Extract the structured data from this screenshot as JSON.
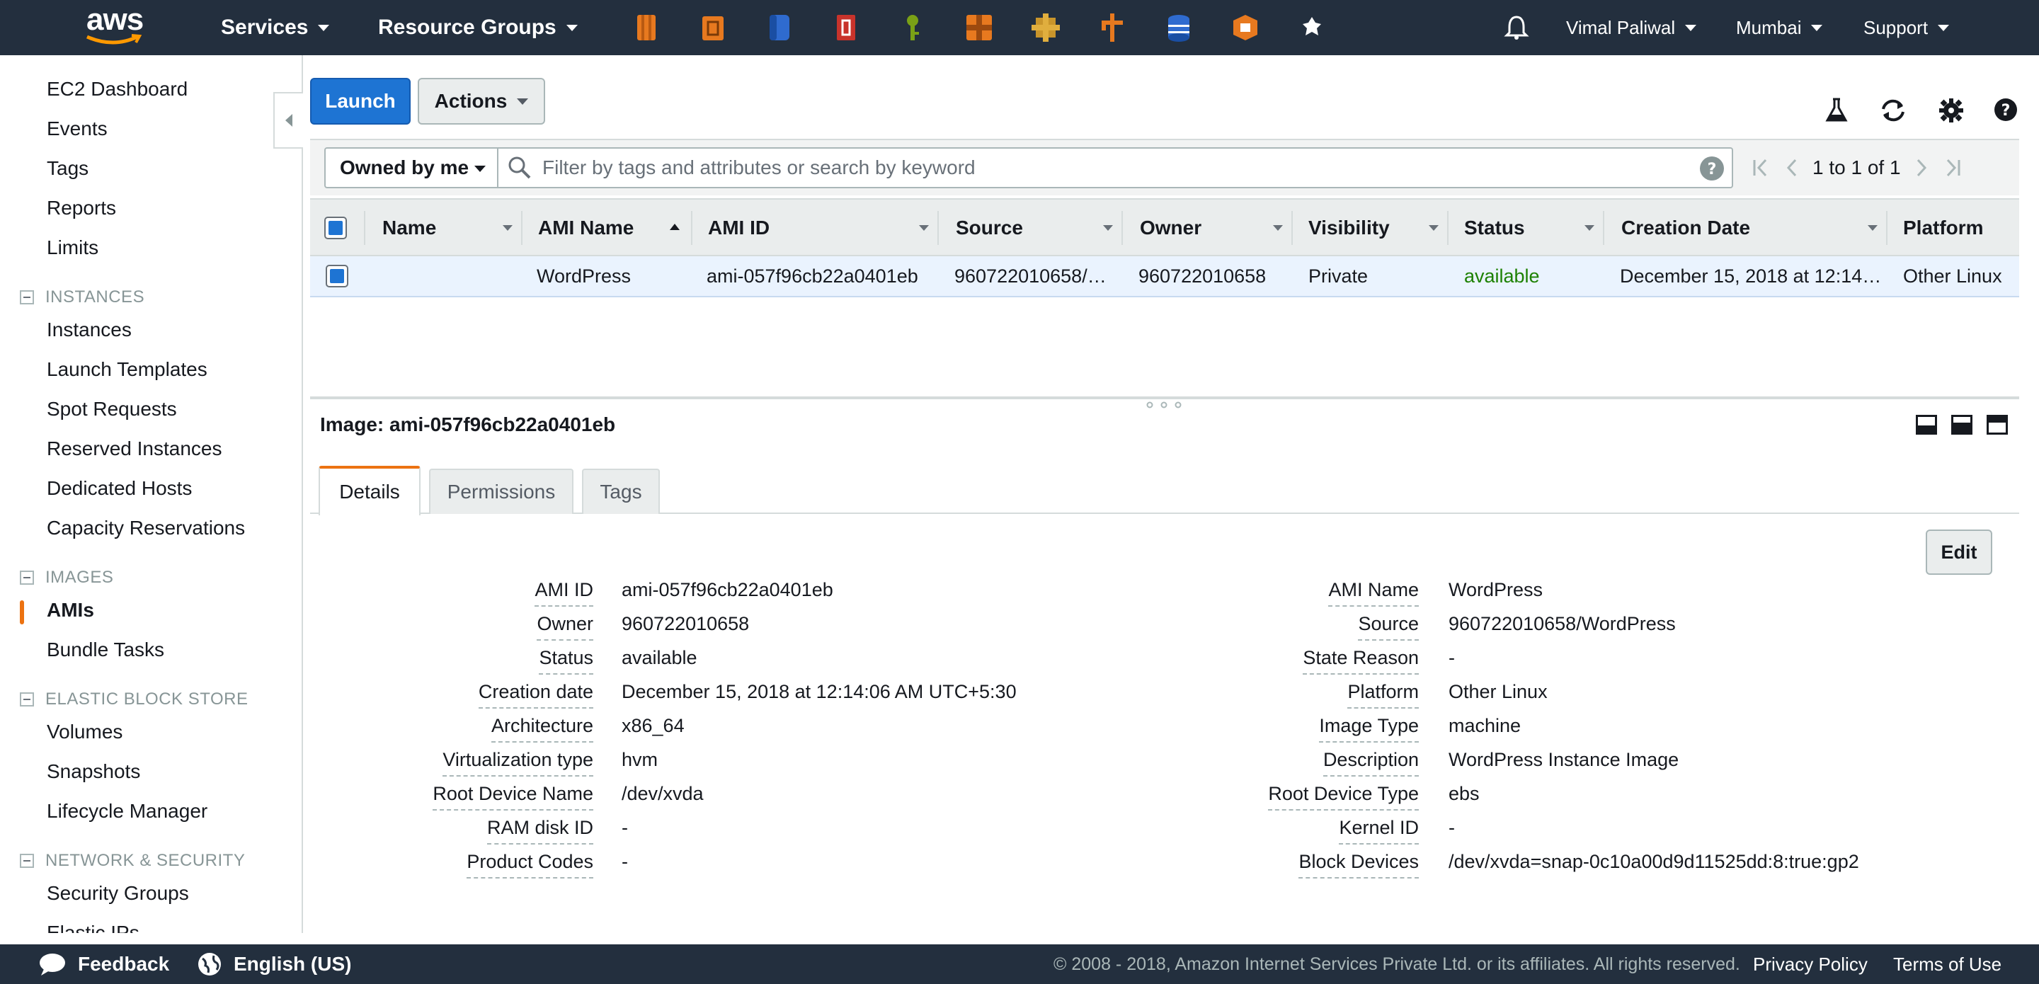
{
  "topnav": {
    "logo": "aws",
    "services": "Services",
    "resource_groups": "Resource Groups",
    "service_icons": [
      "ec2-icon",
      "ecs-icon",
      "s3-icon",
      "codedeploy-icon",
      "iam-icon",
      "api-gateway-icon",
      "cloudwatch-icon",
      "lambda-icon",
      "dynamodb-icon",
      "cloudformation-icon",
      "pin-icon"
    ],
    "user": "Vimal Paliwal",
    "region": "Mumbai",
    "support": "Support"
  },
  "sidebar": {
    "top": [
      "EC2 Dashboard",
      "Events",
      "Tags",
      "Reports",
      "Limits"
    ],
    "sections": [
      {
        "title": "INSTANCES",
        "items": [
          "Instances",
          "Launch Templates",
          "Spot Requests",
          "Reserved Instances",
          "Dedicated Hosts",
          "Capacity Reservations"
        ]
      },
      {
        "title": "IMAGES",
        "items": [
          "AMIs",
          "Bundle Tasks"
        ]
      },
      {
        "title": "ELASTIC BLOCK STORE",
        "items": [
          "Volumes",
          "Snapshots",
          "Lifecycle Manager"
        ]
      },
      {
        "title": "NETWORK & SECURITY",
        "items": [
          "Security Groups",
          "Elastic IPs"
        ]
      }
    ],
    "active": "AMIs"
  },
  "toolbar": {
    "launch": "Launch",
    "actions": "Actions"
  },
  "filter": {
    "owned": "Owned by me",
    "placeholder": "Filter by tags and attributes or search by keyword",
    "pagination": "1 to 1 of 1"
  },
  "table": {
    "columns": [
      "Name",
      "AMI Name",
      "AMI ID",
      "Source",
      "Owner",
      "Visibility",
      "Status",
      "Creation Date",
      "Platform"
    ],
    "rows": [
      {
        "name": "",
        "ami_name": "WordPress",
        "ami_id": "ami-057f96cb22a0401eb",
        "source": "960722010658/…",
        "owner": "960722010658",
        "visibility": "Private",
        "status": "available",
        "creation_date": "December 15, 2018 at 12:14…",
        "platform": "Other Linux"
      }
    ]
  },
  "detail": {
    "title": "Image: ami-057f96cb22a0401eb",
    "tabs": [
      "Details",
      "Permissions",
      "Tags"
    ],
    "edit": "Edit",
    "left": [
      {
        "label": "AMI ID",
        "value": "ami-057f96cb22a0401eb"
      },
      {
        "label": "Owner",
        "value": "960722010658"
      },
      {
        "label": "Status",
        "value": "available"
      },
      {
        "label": "Creation date",
        "value": "December 15, 2018 at 12:14:06 AM UTC+5:30"
      },
      {
        "label": "Architecture",
        "value": "x86_64"
      },
      {
        "label": "Virtualization type",
        "value": "hvm"
      },
      {
        "label": "Root Device Name",
        "value": "/dev/xvda"
      },
      {
        "label": "RAM disk ID",
        "value": "-"
      },
      {
        "label": "Product Codes",
        "value": "-"
      }
    ],
    "right": [
      {
        "label": "AMI Name",
        "value": "WordPress"
      },
      {
        "label": "Source",
        "value": "960722010658/WordPress"
      },
      {
        "label": "State Reason",
        "value": "-"
      },
      {
        "label": "Platform",
        "value": "Other Linux"
      },
      {
        "label": "Image Type",
        "value": "machine"
      },
      {
        "label": "Description",
        "value": "WordPress Instance Image"
      },
      {
        "label": "Root Device Type",
        "value": "ebs"
      },
      {
        "label": "Kernel ID",
        "value": "-"
      },
      {
        "label": "Block Devices",
        "value": "/dev/xvda=snap-0c10a00d9d11525dd:8:true:gp2"
      }
    ]
  },
  "footer": {
    "feedback": "Feedback",
    "language": "English (US)",
    "copyright": "© 2008 - 2018, Amazon Internet Services Private Ltd. or its affiliates. All rights reserved.",
    "privacy": "Privacy Policy",
    "terms": "Terms of Use"
  },
  "colors": {
    "nav_bg": "#232f3e",
    "accent": "#ec7211",
    "primary": "#1e74d3",
    "status_ok": "#1d8102"
  }
}
